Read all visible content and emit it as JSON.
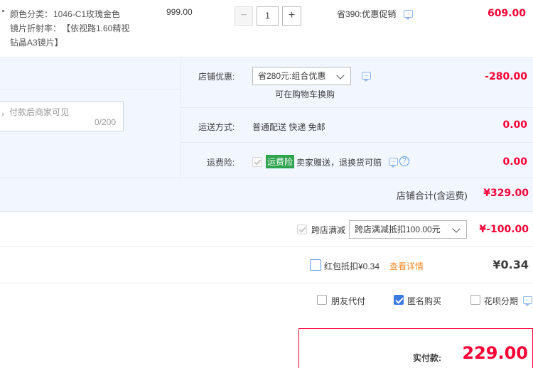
{
  "item": {
    "attr1_label": "颜色分类：",
    "attr1_value": "1046-C1玫瑰金色",
    "attr2_label": "镜片折射率：",
    "attr2_value": "【依视路1.60精视",
    "attr2_value_line2": "钻晶A3镜片】",
    "price": "999.00",
    "quantity": "1",
    "minus_label": "−",
    "plus_label": "+",
    "promo": "省390:优惠促销",
    "subtotal": "609.00"
  },
  "shop": {
    "discount_label": "店铺优惠:",
    "discount_select": "省280元:组合优惠",
    "discount_note": "可在购物车换购",
    "discount_amount": "-280.00",
    "message_placeholder": "，付款后商家可见",
    "message_count": "0/200",
    "shipping_label": "运送方式:",
    "shipping_value": "普通配送 快递 免邮",
    "shipping_amount": "0.00",
    "insurance_label": "运费险:",
    "insurance_badge": "运费险",
    "insurance_text": "卖家赠送，退换货可赔",
    "insurance_amount": "0.00",
    "total_label": "店铺合计(含运费)",
    "total_amount": "¥329.00"
  },
  "cross_store": {
    "label": "跨店满减",
    "select": "跨店满减抵扣100.00元",
    "amount": "¥-100.00"
  },
  "red_packet": {
    "label": "红包抵扣¥0.34",
    "link": "查看详情",
    "amount": "¥0.34"
  },
  "options": {
    "friend_pay": "朋友代付",
    "anonymous": "匿名购买",
    "installment": "花呗分期"
  },
  "pay": {
    "label": "实付款:",
    "amount": "229.00"
  },
  "colors": {
    "accent_red": "#ff0036",
    "panel_blue": "#f2f7ff",
    "badge_green": "#2ea44f",
    "link_orange": "#f58b2b"
  }
}
